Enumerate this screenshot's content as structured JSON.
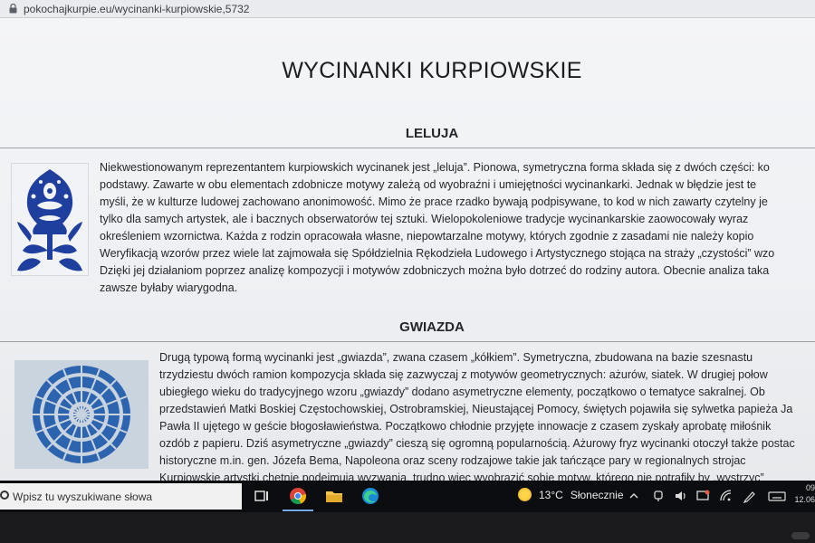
{
  "browser": {
    "url": "pokochajkurpie.eu/wycinanki-kurpiowskie,5732"
  },
  "page": {
    "title": "WYCINANKI KURPIOWSKIE",
    "sections": [
      {
        "heading": "LELUJA",
        "lines": [
          "Niekwestionowanym reprezentantem kurpiowskich wycinanek jest „leluja”. Pionowa, symetryczna forma składa się z dwóch części: ko",
          "podstawy. Zawarte w obu elementach zdobnicze motywy zależą od wyobraźni i umiejętności wycinankarki. Jednak w błędzie jest te",
          "myśli, że w kulturze ludowej zachowano anonimowość. Mimo że prace rzadko bywają podpisywane, to kod w nich zawarty czytelny je",
          "tylko dla samych artystek, ale i bacznych obserwatorów tej sztuki. Wielopokoleniowe tradycje wycinankarskie zaowocowały wyraz",
          "określeniem wzornictwa. Każda z rodzin opracowała własne, niepowtarzalne motywy, których zgodnie z zasadami nie należy kopio",
          "Weryfikacją wzorów przez wiele lat zajmowała się Spółdzielnia Rękodzieła Ludowego i Artystycznego stojąca na straży „czystości” wzo",
          "Dzięki jej działaniom poprzez analizę kompozycji i motywów zdobniczych można było dotrzeć do rodziny autora. Obecnie analiza taka",
          "zawsze byłaby wiarygodna."
        ]
      },
      {
        "heading": "GWIAZDA",
        "lines": [
          "Drugą typową formą wycinanki jest „gwiazda”, zwana czasem „kółkiem”. Symetryczna, zbudowana na bazie szesnastu",
          "trzydziestu dwóch ramion kompozycja składa się zazwyczaj z motywów geometrycznych: ażurów, siatek. W drugiej połow",
          "ubiegłego wieku do tradycyjnego wzoru „gwiazdy” dodano asymetryczne elementy, początkowo o tematyce sakralnej. Ob",
          "przedstawień Matki Boskiej Częstochowskiej, Ostrobramskiej, Nieustającej Pomocy, świętych pojawiła się sylwetka papieża Ja",
          "Pawła II ujętego w geście błogosławieństwa. Początkowo chłodnie przyjęte innowacje z czasem zyskały aprobatę miłośnik",
          "ozdób z papieru. Dziś asymetryczne „gwiazdy” cieszą się ogromną popularnością. Ażurowy fryz wycinanki otoczył także postac",
          "historyczne m.in. gen. Józefa Bema, Napoleona oraz sceny rodzajowe takie jak tańczące pary w regionalnych strojac",
          "Kurpiowskie artystki chętnie podejmują wyzwania, trudno więc wyobrazić sobie motyw, którego nie potrafiły by „wystrzyc”"
        ]
      }
    ]
  },
  "taskbar": {
    "search_placeholder": "Wpisz tu wyszukiwane słowa",
    "weather": {
      "temp": "13°C",
      "condition": "Słonecznie"
    },
    "clock": {
      "time": "09",
      "date": "12.06"
    },
    "icons": [
      "search-icon",
      "task-view-icon",
      "chrome-icon",
      "file-explorer-icon",
      "edge-icon",
      "sun-icon",
      "chevron-up-icon",
      "meet-now-icon",
      "volume-icon",
      "screen-capture-icon",
      "wifi-icon",
      "pen-icon",
      "keyboard-icon"
    ]
  },
  "colors": {
    "wycinanka_blue": "#1f3f9e",
    "taskbar": "#0c0d10",
    "page_bg": "#f2f3f5"
  }
}
